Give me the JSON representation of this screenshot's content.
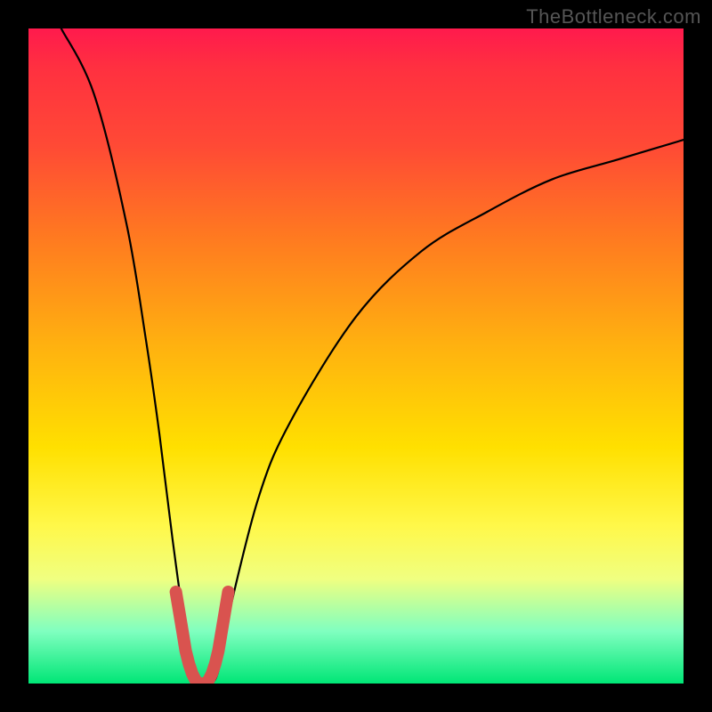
{
  "watermark": "TheBottleneck.com",
  "chart_data": {
    "type": "line",
    "title": "",
    "xlabel": "",
    "ylabel": "",
    "xlim": [
      0,
      100
    ],
    "ylim": [
      0,
      100
    ],
    "series": [
      {
        "name": "curve",
        "x": [
          5,
          10,
          15,
          18,
          20,
          22,
          24,
          26,
          27,
          28,
          29,
          30,
          35,
          40,
          50,
          60,
          70,
          80,
          90,
          100
        ],
        "y": [
          100,
          90,
          70,
          52,
          38,
          22,
          8,
          0,
          0,
          0,
          2,
          8,
          28,
          40,
          56,
          66,
          72,
          77,
          80,
          83
        ]
      }
    ],
    "highlight": {
      "name": "marker-segment",
      "color": "#d9534f",
      "x": [
        22.5,
        23,
        23.5,
        24,
        24.5,
        25,
        25.5,
        26,
        26.5,
        27,
        27.5,
        28,
        28.5,
        29,
        29.5,
        30,
        30.5
      ],
      "y": [
        14,
        11,
        8,
        5,
        3,
        1.5,
        0.5,
        0,
        0,
        0,
        0.5,
        1.5,
        3,
        5,
        8,
        11,
        14
      ]
    }
  }
}
